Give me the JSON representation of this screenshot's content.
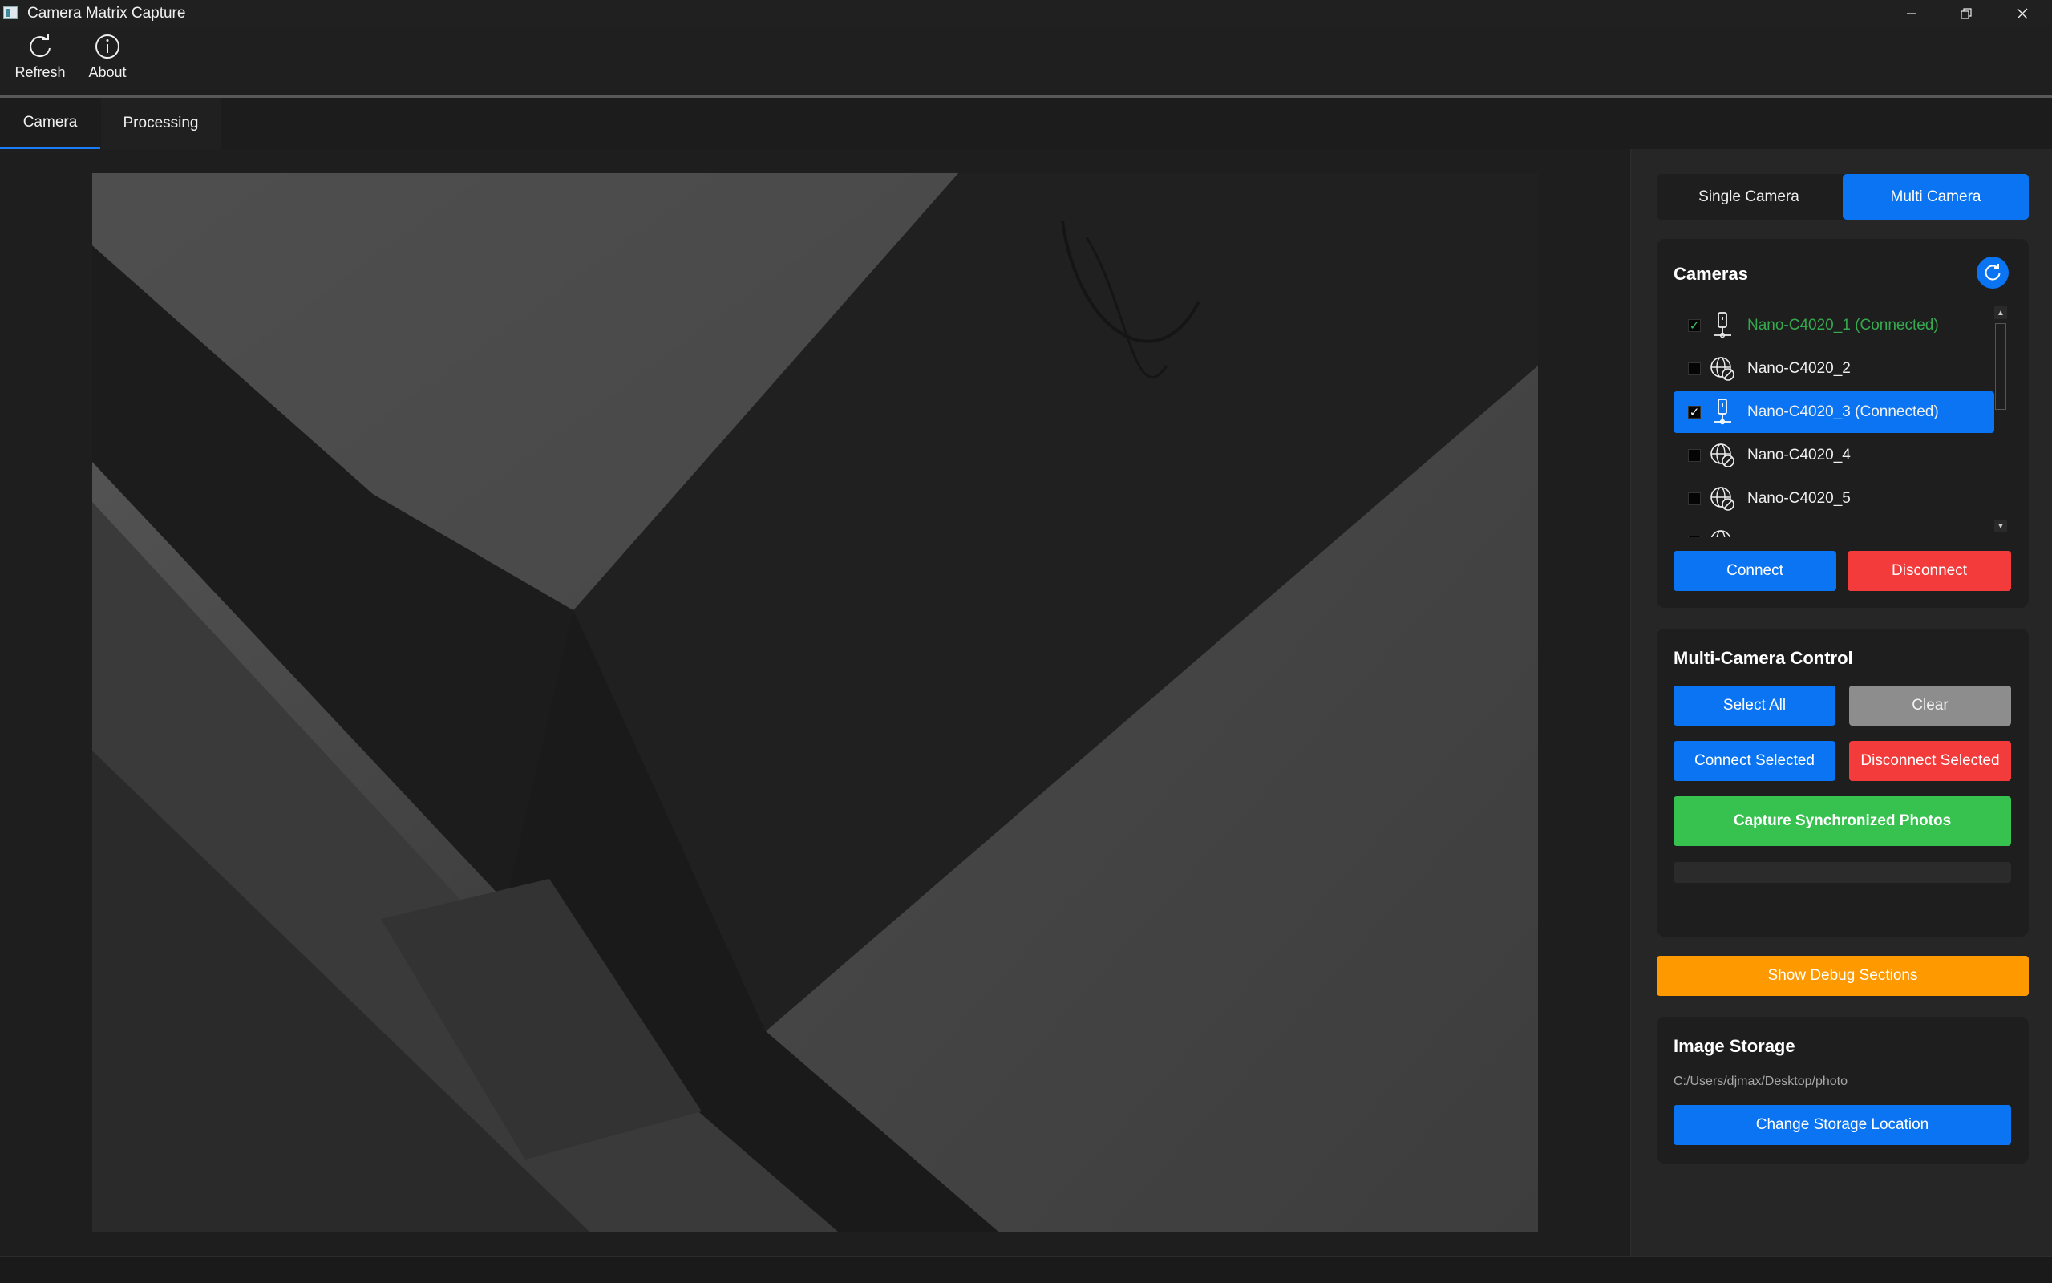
{
  "window": {
    "title": "Camera Matrix Capture",
    "controls": [
      "minimize",
      "restore",
      "close"
    ]
  },
  "toolbar": {
    "refresh_label": "Refresh",
    "about_label": "About"
  },
  "tabs": [
    {
      "label": "Camera",
      "active": true
    },
    {
      "label": "Processing",
      "active": false
    }
  ],
  "mode": {
    "single_label": "Single Camera",
    "multi_label": "Multi Camera",
    "active": "Multi Camera"
  },
  "cameras": {
    "title": "Cameras",
    "items": [
      {
        "label": "Nano-C4020_1 (Connected)",
        "checked": true,
        "status": "connected"
      },
      {
        "label": "Nano-C4020_2",
        "checked": false,
        "status": "offline"
      },
      {
        "label": "Nano-C4020_3 (Connected)",
        "checked": true,
        "status": "connected",
        "selected": true
      },
      {
        "label": "Nano-C4020_4",
        "checked": false,
        "status": "offline"
      },
      {
        "label": "Nano-C4020_5",
        "checked": false,
        "status": "offline"
      }
    ],
    "connect_label": "Connect",
    "disconnect_label": "Disconnect"
  },
  "multi_control": {
    "title": "Multi-Camera Control",
    "select_all_label": "Select All",
    "clear_label": "Clear",
    "connect_selected_label": "Connect Selected",
    "disconnect_selected_label": "Disconnect Selected",
    "capture_label": "Capture Synchronized Photos",
    "progress": 0
  },
  "debug": {
    "toggle_label": "Show Debug Sections"
  },
  "storage": {
    "title": "Image Storage",
    "path": "C:/Users/djmax/Desktop/photo",
    "change_label": "Change Storage Location"
  },
  "colors": {
    "accent_blue": "#0a74f2",
    "danger_red": "#f43b3b",
    "success_green": "#37c24f",
    "warning_orange": "#ff9900",
    "connected_text": "#36a94f"
  }
}
